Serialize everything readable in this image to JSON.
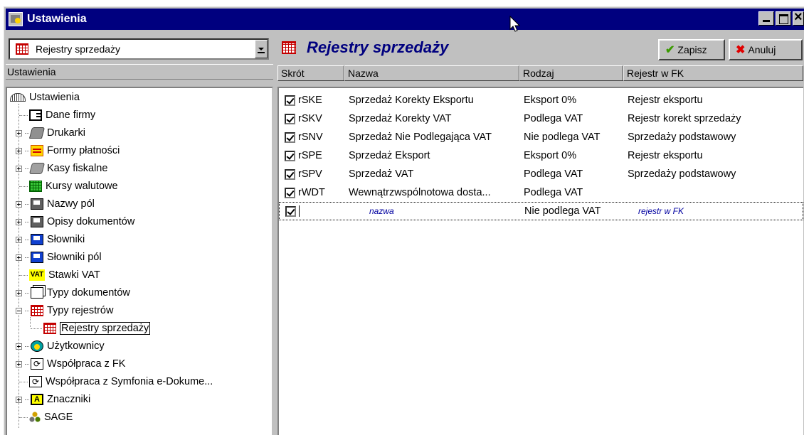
{
  "window": {
    "title": "Ustawienia"
  },
  "left": {
    "combo_value": "Rejestry sprzedaży",
    "header": "Ustawienia",
    "tree": [
      {
        "label": "Ustawienia",
        "icon": "tree-root-icon"
      },
      {
        "label": "Dane firmy",
        "icon": "card-icon"
      },
      {
        "label": "Drukarki",
        "icon": "printer-icon"
      },
      {
        "label": "Formy płatności",
        "icon": "payment-icon"
      },
      {
        "label": "Kasy fiskalne",
        "icon": "cash-register-icon"
      },
      {
        "label": "Kursy walutowe",
        "icon": "currency-table-icon"
      },
      {
        "label": "Nazwy pól",
        "icon": "field-names-icon"
      },
      {
        "label": "Opisy dokumentów",
        "icon": "document-descriptions-icon"
      },
      {
        "label": "Słowniki",
        "icon": "dictionary-icon"
      },
      {
        "label": "Słowniki pól",
        "icon": "field-dictionary-icon"
      },
      {
        "label": "Stawki VAT",
        "icon": "vat-icon"
      },
      {
        "label": "Typy dokumentów",
        "icon": "document-types-icon"
      },
      {
        "label": "Typy rejestrów",
        "icon": "register-types-icon"
      },
      {
        "label": "Rejestry sprzedaży",
        "icon": "sales-register-icon"
      },
      {
        "label": "Użytkownicy",
        "icon": "users-icon"
      },
      {
        "label": "Współpraca z FK",
        "icon": "sync-icon"
      },
      {
        "label": "Współpraca z Symfonia e-Dokume...",
        "icon": "sync-icon"
      },
      {
        "label": "Znaczniki",
        "icon": "tag-icon"
      },
      {
        "label": "SAGE",
        "icon": "sage-icon"
      }
    ]
  },
  "right": {
    "title": "Rejestry sprzedaży",
    "save_label": "Zapisz",
    "cancel_label": "Anuluj",
    "columns": [
      "Skrót",
      "Nazwa",
      "Rodzaj",
      "Rejestr w FK"
    ],
    "rows": [
      {
        "checked": true,
        "code": "rSKE",
        "name": "Sprzedaż Korekty Eksportu",
        "kind": "Eksport 0%",
        "fk": "Rejestr eksportu"
      },
      {
        "checked": true,
        "code": "rSKV",
        "name": "Sprzedaż Korekty VAT",
        "kind": "Podlega VAT",
        "fk": "Rejestr korekt sprzedaży"
      },
      {
        "checked": true,
        "code": "rSNV",
        "name": "Sprzedaż Nie Podlegająca VAT",
        "kind": "Nie podlega VAT",
        "fk": "Sprzedaży podstawowy"
      },
      {
        "checked": true,
        "code": "rSPE",
        "name": "Sprzedaż Eksport",
        "kind": "Eksport 0%",
        "fk": "Rejestr eksportu"
      },
      {
        "checked": true,
        "code": "rSPV",
        "name": "Sprzedaż VAT",
        "kind": "Podlega VAT",
        "fk": "Sprzedaży podstawowy"
      },
      {
        "checked": true,
        "code": "rWDT",
        "name": "Wewnątrzwspólnotowa dosta...",
        "kind": "Podlega VAT",
        "fk": ""
      }
    ],
    "new_row": {
      "checked": true,
      "name_placeholder": "nazwa",
      "kind": "Nie podlega VAT",
      "fk_placeholder": "rejestr w FK"
    }
  }
}
